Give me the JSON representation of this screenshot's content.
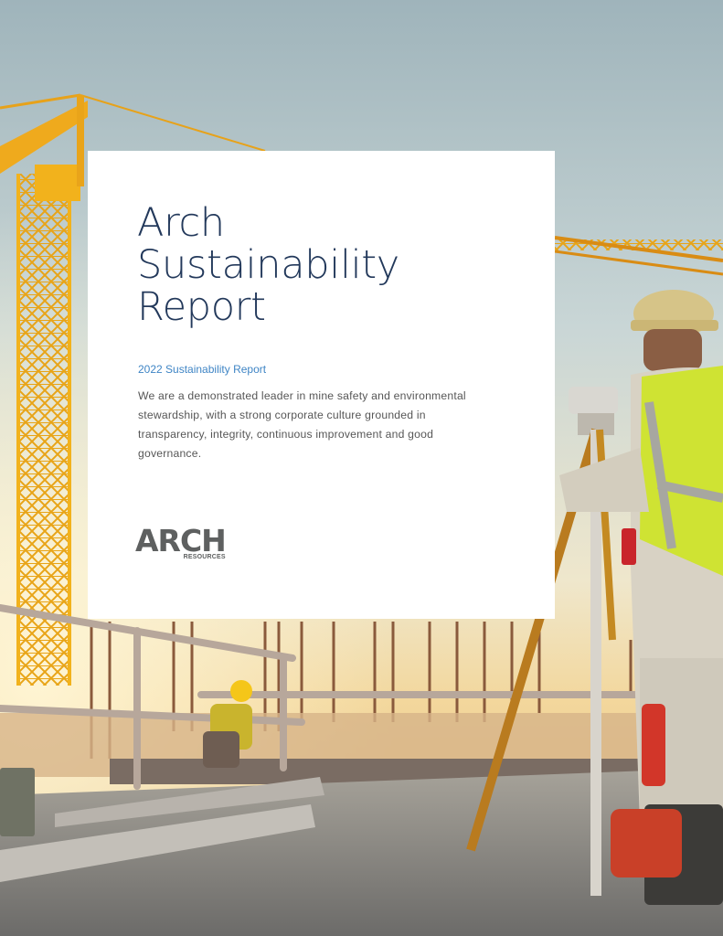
{
  "cover": {
    "title_lines": [
      "Arch",
      "Sustainability",
      "Report"
    ],
    "subtitle": "2022 Sustainability Report",
    "intro": "We are a demonstrated leader in mine safety and environmental stewardship, with a strong corporate culture grounded in transparency, integrity, continuous improvement and good governance."
  },
  "logo": {
    "wordmark": "ARCH",
    "tagline": "RESOURCES"
  },
  "colors": {
    "title": "#23395b",
    "subtitle": "#3f85c5",
    "body": "#565656",
    "logo": "#5e6060",
    "crane": "#f2b21c",
    "vest": "#d8f03a"
  },
  "background_photo": {
    "subject": "construction site with cranes and survey worker",
    "icons": [
      "crane-icon",
      "hardhat-icon",
      "survey-instrument-icon"
    ]
  }
}
